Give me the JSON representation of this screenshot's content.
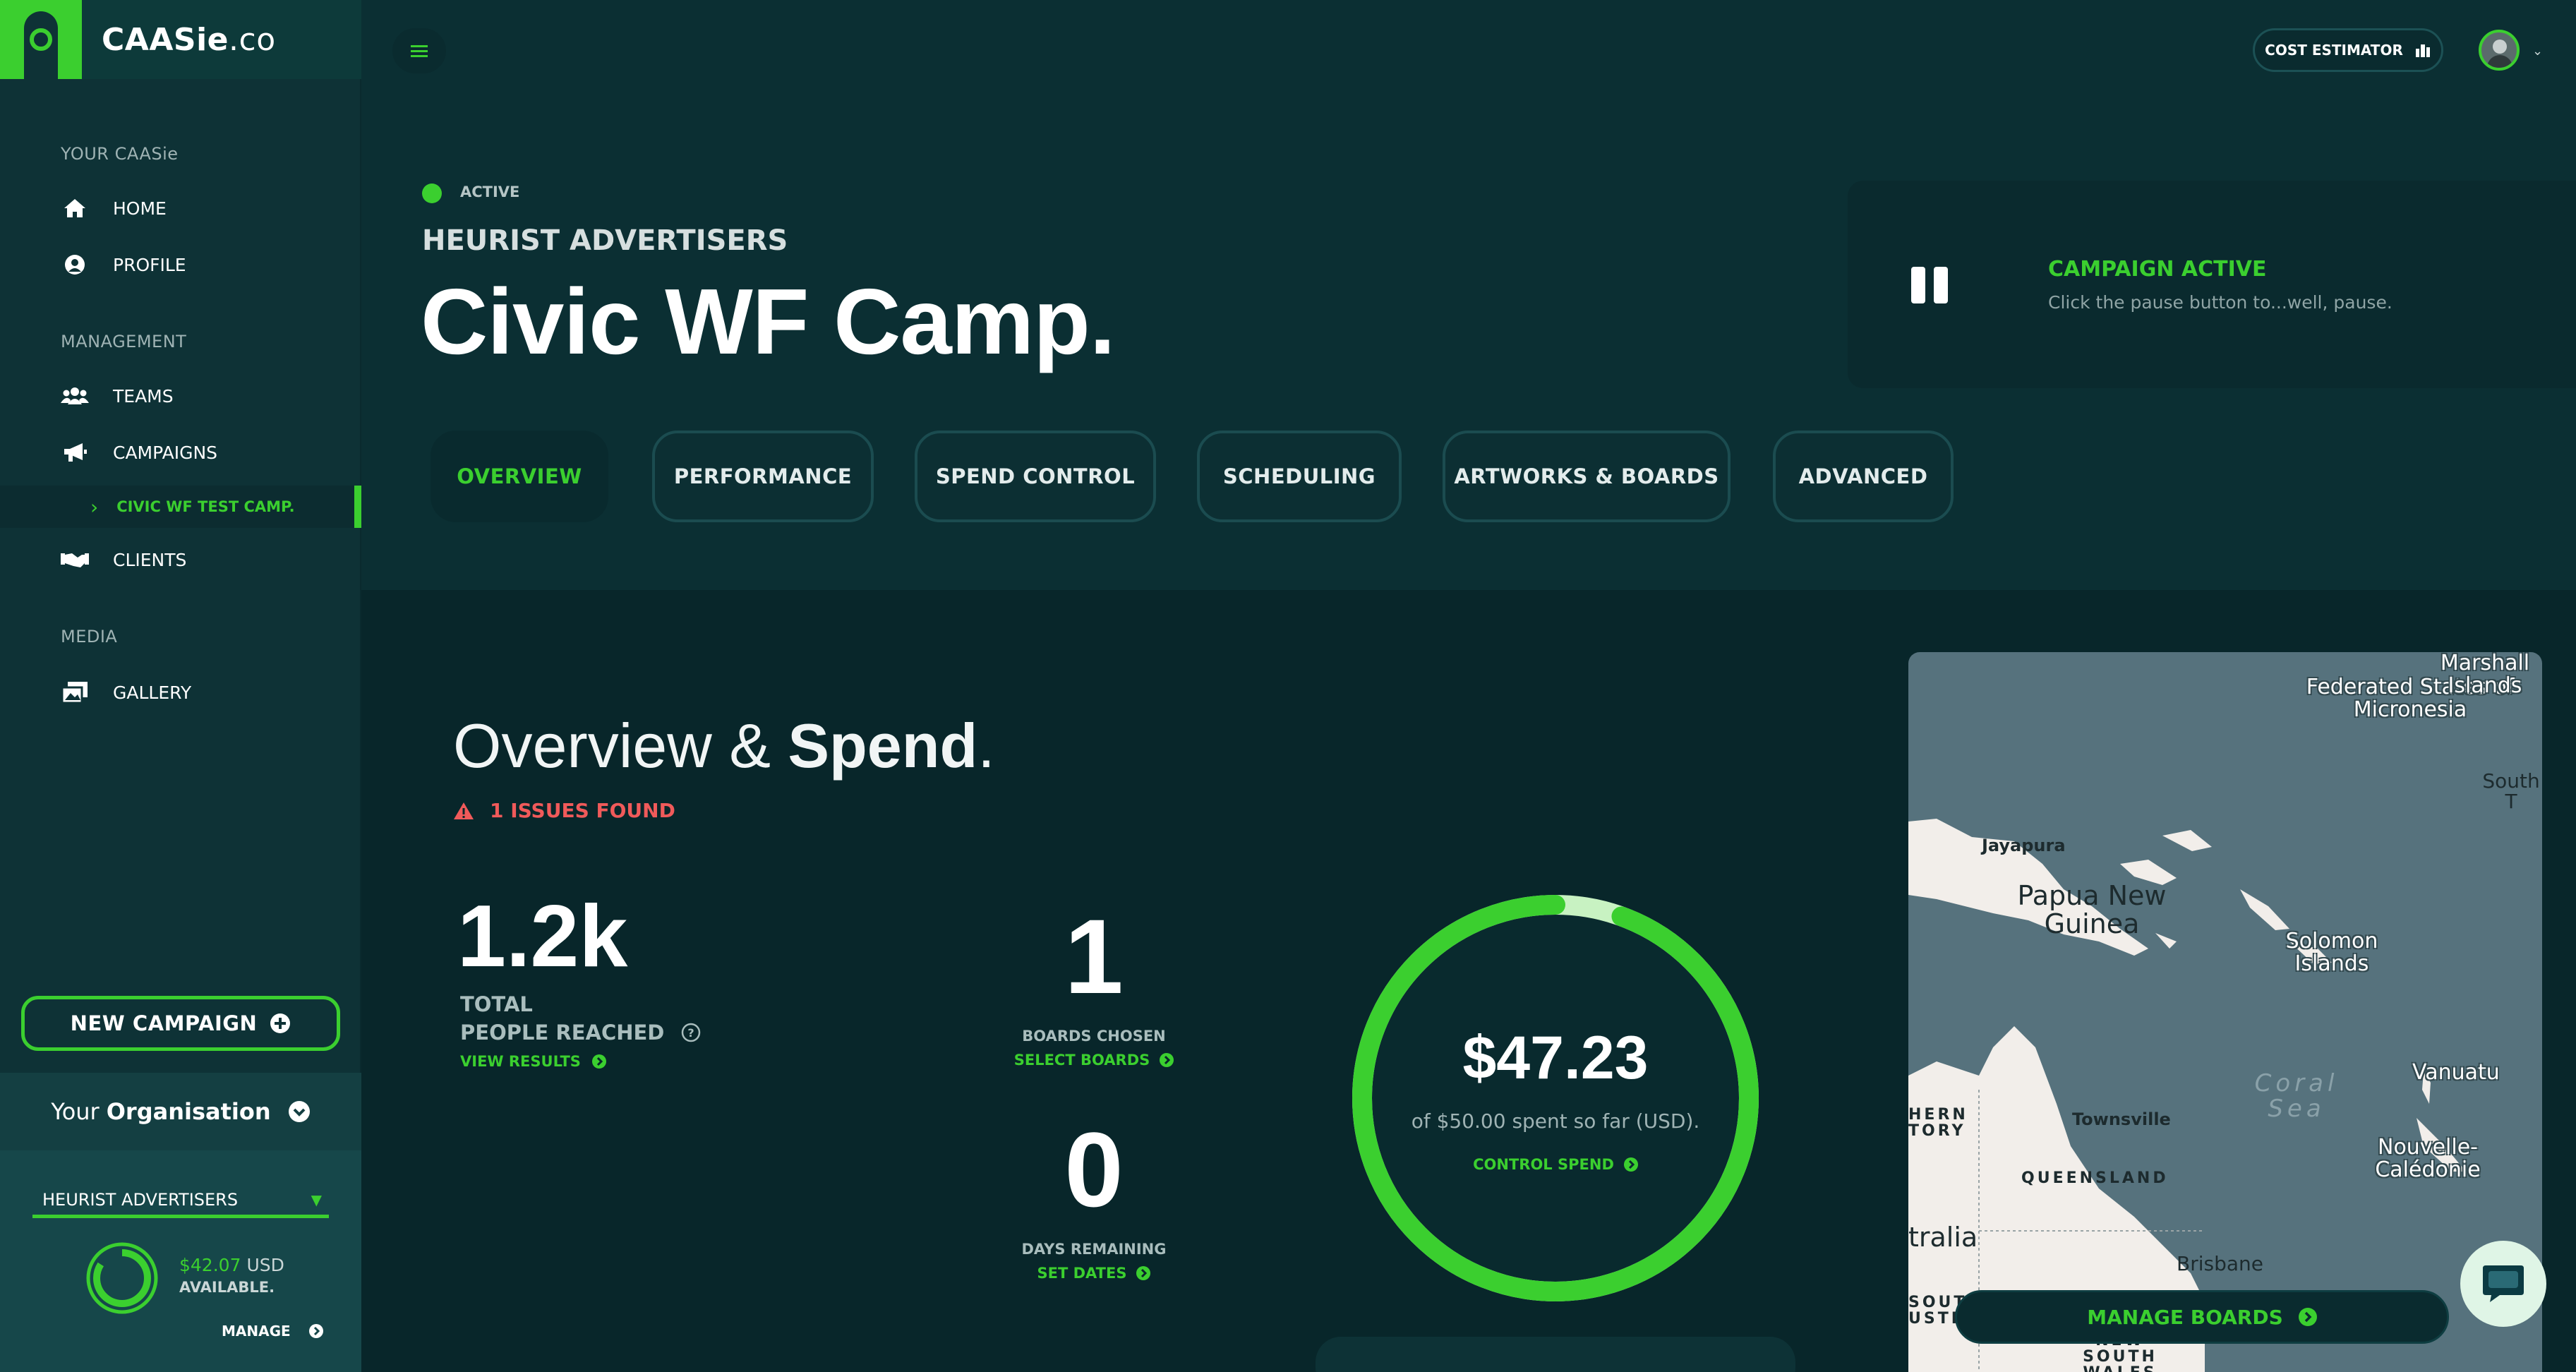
{
  "brand": {
    "name": "CAASie",
    "suffix": ".co"
  },
  "sidebar": {
    "sections": [
      {
        "title": "YOUR CAASie"
      },
      {
        "title": "MANAGEMENT"
      },
      {
        "title": "MEDIA"
      }
    ],
    "items": [
      {
        "label": "HOME",
        "icon": "home-icon"
      },
      {
        "label": "PROFILE",
        "icon": "user-circle-icon"
      },
      {
        "label": "TEAMS",
        "icon": "users-icon"
      },
      {
        "label": "CAMPAIGNS",
        "icon": "megaphone-icon"
      },
      {
        "label": "CLIENTS",
        "icon": "handshake-icon"
      },
      {
        "label": "GALLERY",
        "icon": "images-icon"
      }
    ],
    "sub_item": {
      "label": "CIVIC WF TEST CAMP."
    },
    "new_campaign": "NEW CAMPAIGN",
    "org": {
      "title_prefix": "Your",
      "title_strong": "Organisation",
      "selected": "HEURIST ADVERTISERS",
      "amount": "$42.07",
      "currency": "USD",
      "available": "AVAILABLE.",
      "manage": "MANAGE",
      "available_fraction": 0.84
    }
  },
  "topbar": {
    "cost_estimator": "COST ESTIMATOR"
  },
  "campaign": {
    "status": "ACTIVE",
    "client": "HEURIST ADVERTISERS",
    "title": "Civic WF Camp.",
    "pause_card": {
      "title": "CAMPAIGN ACTIVE",
      "subtitle": "Click the pause button to...well, pause."
    },
    "tabs": [
      {
        "label": "OVERVIEW",
        "active": true
      },
      {
        "label": "PERFORMANCE"
      },
      {
        "label": "SPEND CONTROL"
      },
      {
        "label": "SCHEDULING"
      },
      {
        "label": "ARTWORKS & BOARDS"
      },
      {
        "label": "ADVANCED"
      }
    ]
  },
  "overview": {
    "title_light": "Overview &",
    "title_strong": "Spend",
    "title_dot": ".",
    "issues": "1 ISSUES FOUND",
    "reach": {
      "value": "1.2k",
      "label1": "TOTAL",
      "label2": "PEOPLE REACHED",
      "link": "VIEW RESULTS"
    },
    "boards": {
      "value": "1",
      "label": "BOARDS CHOSEN",
      "link": "SELECT BOARDS"
    },
    "days": {
      "value": "0",
      "label": "DAYS REMAINING",
      "link": "SET DATES"
    },
    "spend": {
      "amount": "$47.23",
      "subtitle": "of $50.00 spent so far (USD).",
      "link": "CONTROL SPEND",
      "spent": 47.23,
      "budget": 50.0
    }
  },
  "map": {
    "labels": {
      "png": "Papua New Guinea",
      "jayapura": "Jayapura",
      "micronesia": "Federated States of Micronesia",
      "marshall": "Marshall Islands",
      "south": "South T",
      "solomon": "Solomon Islands",
      "coral": "Coral Sea",
      "vanuatu": "Vanuatu",
      "caledonie": "Nouvelle-Calédonie",
      "townsville": "Townsville",
      "queensland": "QUEENSLAND",
      "territory": "HERN TORY",
      "australia": "tralia",
      "brisbane": "Brisbane",
      "nsw_left": "SOUT USTRA",
      "nsw": "NEW SOUTH WALES"
    },
    "manage_boards": "MANAGE BOARDS"
  },
  "colors": {
    "accent": "#3bcf2f",
    "background": "#0b2f33",
    "danger": "#f05a5a"
  }
}
